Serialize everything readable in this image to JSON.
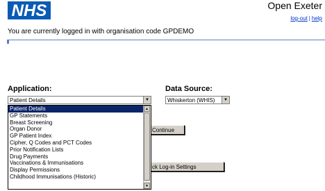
{
  "header": {
    "logo_text": "NHS",
    "app_title": "Open Exeter",
    "logout_label": "log-out",
    "separator": "|",
    "help_label": "help",
    "login_status": "You are currently logged in with organisation code GPDEMO"
  },
  "form": {
    "application_label": "Application:",
    "application_value": "Patient Details",
    "data_source_label": "Data Source:",
    "data_source_value": "Whiskerton (WHIS)",
    "continue_label": "Continue",
    "settings_label": "ck Log-in Settings"
  },
  "dropdown": {
    "options": [
      "Patient Details",
      "GP Statements",
      "Breast Screening",
      "Organ Donor",
      "GP Patient Index",
      "Cipher, Q Codes and PCT Codes",
      "Prior Notification Lists",
      "Drug Payments",
      "Vaccinations & Immunisations",
      "Display Permissions",
      "Childhood Immunisations (Historic)"
    ],
    "selected_index": 0
  },
  "icons": {
    "dropdown_arrow": "chevron-down-icon",
    "scroll_up": "chevron-up-icon",
    "scroll_down": "chevron-down-icon"
  }
}
